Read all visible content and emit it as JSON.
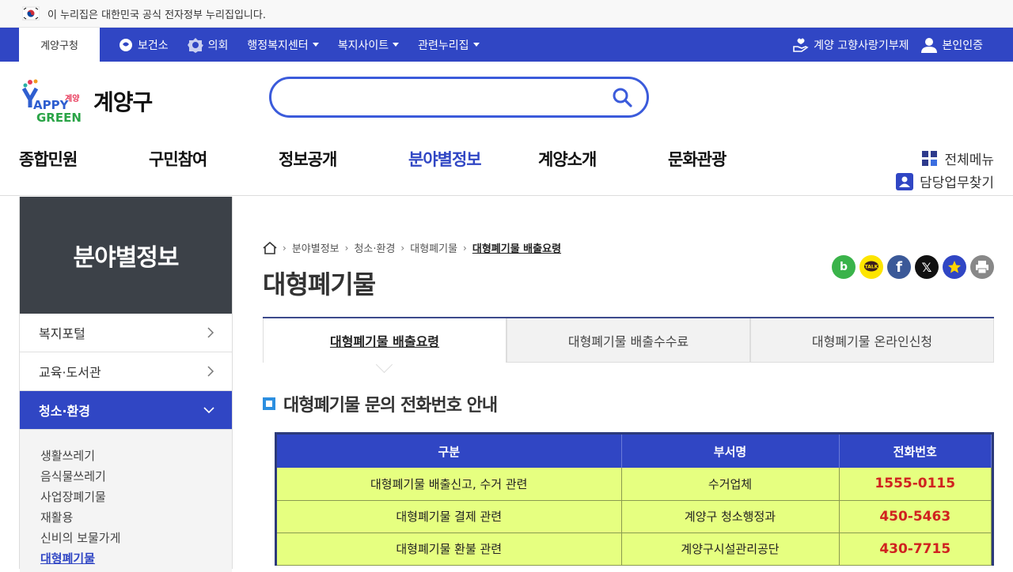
{
  "gov_banner": {
    "text": "이 누리집은 대한민국 공식 전자정부 누리집입니다."
  },
  "topnav": {
    "home_tab": "계양구청",
    "items": [
      {
        "label": "보건소",
        "icon": "health-center-icon"
      },
      {
        "label": "의회",
        "icon": "council-icon"
      },
      {
        "label": "행정복지센터",
        "dropdown": true
      },
      {
        "label": "복지사이트",
        "dropdown": true
      },
      {
        "label": "관련누리집",
        "dropdown": true
      }
    ],
    "right": [
      {
        "label": "계양 고향사랑기부제",
        "icon": "donation-hand-icon"
      },
      {
        "label": "본인인증",
        "icon": "user-icon"
      }
    ]
  },
  "header": {
    "logo_small": "계양",
    "logo_happy": "APPY",
    "logo_green": "GREEN",
    "logo_text": "계양구",
    "search_placeholder": ""
  },
  "gnb": [
    "종합민원",
    "구민참여",
    "정보공개",
    "분야별정보",
    "계양소개",
    "문화관광"
  ],
  "gnb_active": "분야별정보",
  "util": {
    "all_menu": "전체메뉴",
    "find_duty": "담당업무찾기"
  },
  "sidebar": {
    "title": "분야별정보",
    "items": [
      {
        "label": "복지포털"
      },
      {
        "label": "교육·도서관"
      },
      {
        "label": "청소·환경"
      }
    ],
    "sub_items": [
      "생활쓰레기",
      "음식물쓰레기",
      "사업장폐기물",
      "재활용",
      "신비의 보물가게",
      "대형폐기물"
    ],
    "current_sub": "대형폐기물"
  },
  "breadcrumb": [
    "분야별정보",
    "청소·환경",
    "대형폐기물",
    "대형폐기물 배출요령"
  ],
  "page_title": "대형폐기물",
  "tabs": [
    "대형폐기물 배출요령",
    "대형폐기물 배출수수료",
    "대형폐기물 온라인신청"
  ],
  "section_title": "대형폐기물 문의 전화번호 안내",
  "table": {
    "headers": [
      "구분",
      "부서명",
      "전화번호"
    ],
    "rows": [
      [
        "대형폐기물 배출신고, 수거 관련",
        "수거업체",
        "1555-0115"
      ],
      [
        "대형폐기물 결제 관련",
        "계양구 청소행정과",
        "450-5463"
      ],
      [
        "대형폐기물 환불 관련",
        "계양구시설관리공단",
        "430-7715"
      ]
    ]
  },
  "colors": {
    "brand_blue": "#3046c4",
    "sidebar_dark": "#3c4148",
    "table_row": "#e6ff80",
    "phone_red": "#d0221f"
  }
}
